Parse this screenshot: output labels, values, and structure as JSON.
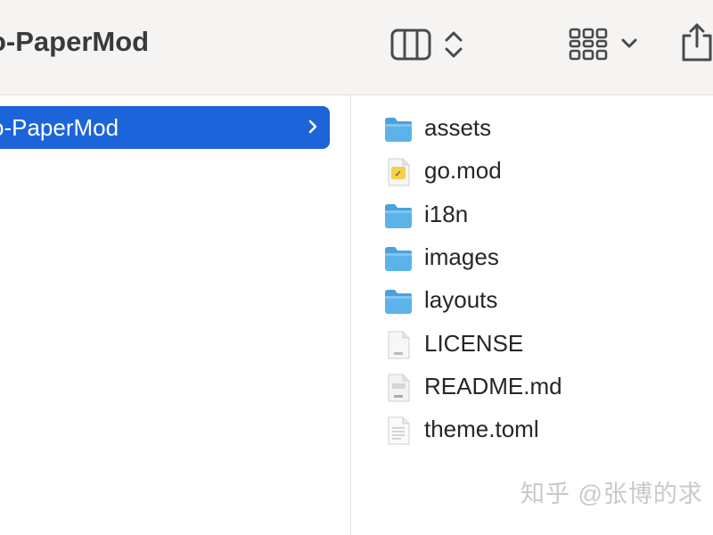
{
  "window": {
    "title": "o-PaperMod"
  },
  "toolbar": {
    "icons": [
      "view-columns-icon",
      "up-down-chevron-icon",
      "grid-view-icon",
      "chevron-down-icon",
      "share-icon"
    ]
  },
  "sidebar": {
    "selected_item": "o-PaperMod"
  },
  "files": [
    {
      "name": "assets",
      "kind": "folder"
    },
    {
      "name": "go.mod",
      "kind": "gomod"
    },
    {
      "name": "i18n",
      "kind": "folder"
    },
    {
      "name": "images",
      "kind": "folder"
    },
    {
      "name": "layouts",
      "kind": "folder"
    },
    {
      "name": "LICENSE",
      "kind": "txt"
    },
    {
      "name": "README.md",
      "kind": "md"
    },
    {
      "name": "theme.toml",
      "kind": "doc"
    }
  ],
  "watermark": {
    "text": "知乎 @张博的求"
  },
  "colors": {
    "selection": "#1b64da",
    "folder": "#5cb3ea",
    "toolbar_bg": "#f6f4f2"
  }
}
